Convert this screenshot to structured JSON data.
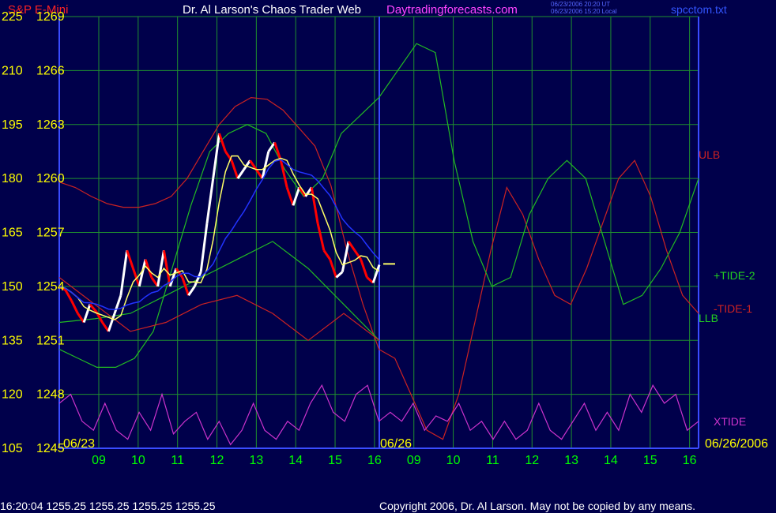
{
  "header": {
    "instrument": "S&P E-Mini",
    "title": "Dr. Al Larson's Chaos Trader Web",
    "website": "Daytradingforecasts.com",
    "timestamp_ut": "06/23/2006 20:20 UT",
    "timestamp_local": "06/23/2006 15:20 Local",
    "filename": "spcctom.txt"
  },
  "footer": {
    "status": "16:20:04   1255.25  1255.25  1255.25  1255.25",
    "copyright": "Copyright 2006, Dr. Al Larson. May not be copied by any means."
  },
  "colors": {
    "background": "#00004b",
    "grid": "#1f8f2f",
    "axis": "#3a4cff",
    "left_labels": "#ffff00",
    "time_labels": "#00ff00",
    "ulb": "#cc2222",
    "llb": "#22bb22",
    "xtide": "#cc33cc",
    "price_up": "#ffffff",
    "price_down": "#ff0000",
    "moving_avg_fast": "#ffff66",
    "moving_avg_slow": "#2233ff",
    "title_color": "#ffffff",
    "website_color": "#ff44ff",
    "filename_color": "#3355ff"
  },
  "chart_data": {
    "type": "line",
    "title": "Dr. Al Larson's Chaos Trader Web",
    "instrument": "S&P E-Mini",
    "grid": true,
    "y_axis_left_ticks": [
      "225",
      "210",
      "195",
      "180",
      "165",
      "150",
      "135",
      "120",
      "105"
    ],
    "y_axis_price_ticks": [
      "1269",
      "1266",
      "1263",
      "1260",
      "1257",
      "1254",
      "1251",
      "1248",
      "1245"
    ],
    "ylim_price": [
      1245,
      1269
    ],
    "x_ticks": [
      "09",
      "10",
      "11",
      "12",
      "13",
      "14",
      "15",
      "16",
      "09",
      "10",
      "11",
      "12",
      "13",
      "14",
      "15",
      "16"
    ],
    "date_labels": [
      "06/23",
      "06/26",
      "06/26/2006"
    ],
    "current_price": 1255.25,
    "series": [
      {
        "name": "ULB",
        "values": [
          1259.8,
          1259.5,
          1259.0,
          1258.6,
          1258.4,
          1258.4,
          1258.6,
          1259.0,
          1260.0,
          1261.5,
          1263.0,
          1264.0,
          1264.5,
          1264.4,
          1263.8,
          1262.8,
          1261.8,
          1259.6,
          1256.0,
          1253.0,
          1250.5,
          1250.0,
          1248.0,
          1246.0,
          1245.5,
          1248.0,
          1252.0,
          1256.0,
          1259.5,
          1258.0,
          1255.5,
          1253.5,
          1253.0,
          1255.0,
          1257.5,
          1260.0,
          1261.0,
          1259.0,
          1256.0,
          1253.5,
          1252.5
        ]
      },
      {
        "name": "LLB",
        "values": [
          1250.5,
          1250.0,
          1249.5,
          1249.5,
          1250.0,
          1251.5,
          1255.0,
          1258.5,
          1261.5,
          1262.5,
          1263.0,
          1262.5,
          1260.5,
          1259.0,
          1260.0,
          1262.5,
          1263.5,
          1264.5,
          1266.0,
          1267.5,
          1267.0,
          1261.0,
          1256.5,
          1254.0,
          1254.5,
          1258.0,
          1260.0,
          1261.0,
          1260.0,
          1256.5,
          1253.0,
          1253.5,
          1255.0,
          1257.0,
          1260.0
        ]
      },
      {
        "name": "+TIDE-2",
        "values": [
          1252.0,
          1252.2,
          1252.5,
          1253.5,
          1254.5,
          1255.5,
          1256.5,
          1255.0,
          1253.0,
          1251.0
        ]
      },
      {
        "name": "-TIDE-1",
        "values": [
          1254.5,
          1253.0,
          1251.5,
          1252.0,
          1253.0,
          1253.5,
          1252.5,
          1251.0,
          1252.5,
          1251.0
        ]
      },
      {
        "name": "XTIDE",
        "values": [
          1247.5,
          1248.0,
          1246.5,
          1246.0,
          1247.5,
          1246.0,
          1245.5,
          1247.0,
          1246.0,
          1248.0,
          1245.8,
          1246.5,
          1247.0,
          1245.5,
          1246.5,
          1245.2,
          1246.0,
          1247.5,
          1246.0,
          1245.5,
          1246.5,
          1246.0,
          1247.5,
          1248.5,
          1247.0,
          1246.5,
          1248.0,
          1248.5,
          1246.5,
          1247.0,
          1246.5,
          1247.5,
          1246.0,
          1246.8,
          1246.5,
          1247.5,
          1246.0,
          1246.5,
          1245.5,
          1246.5,
          1245.5,
          1246.0,
          1247.5,
          1246.0,
          1245.5,
          1246.5,
          1247.5,
          1246.0,
          1247.0,
          1246.0,
          1248.0,
          1247.0,
          1248.5,
          1247.5,
          1248.0,
          1246.0,
          1246.5
        ]
      },
      {
        "name": "price",
        "values": [
          1254.0,
          1253.8,
          1253.2,
          1252.5,
          1252.0,
          1253.0,
          1252.6,
          1252.0,
          1251.5,
          1252.5,
          1253.5,
          1256.0,
          1255.0,
          1254.0,
          1255.5,
          1254.5,
          1254.0,
          1256.0,
          1254.0,
          1255.0,
          1254.5,
          1253.5,
          1254.0,
          1254.8,
          1257.5,
          1260.0,
          1262.5,
          1261.5,
          1261.0,
          1260.0,
          1260.5,
          1261.0,
          1260.5,
          1260.0,
          1261.5,
          1262.0,
          1261.0,
          1259.5,
          1258.5,
          1259.5,
          1259.0,
          1259.5,
          1257.5,
          1256.0,
          1255.5,
          1254.5,
          1254.8,
          1256.5,
          1256.0,
          1255.5,
          1254.5,
          1254.2,
          1255.2
        ]
      }
    ],
    "legend_labels": [
      "ULB",
      "+TIDE-2",
      "-TIDE-1",
      "LLB",
      "XTIDE"
    ]
  }
}
